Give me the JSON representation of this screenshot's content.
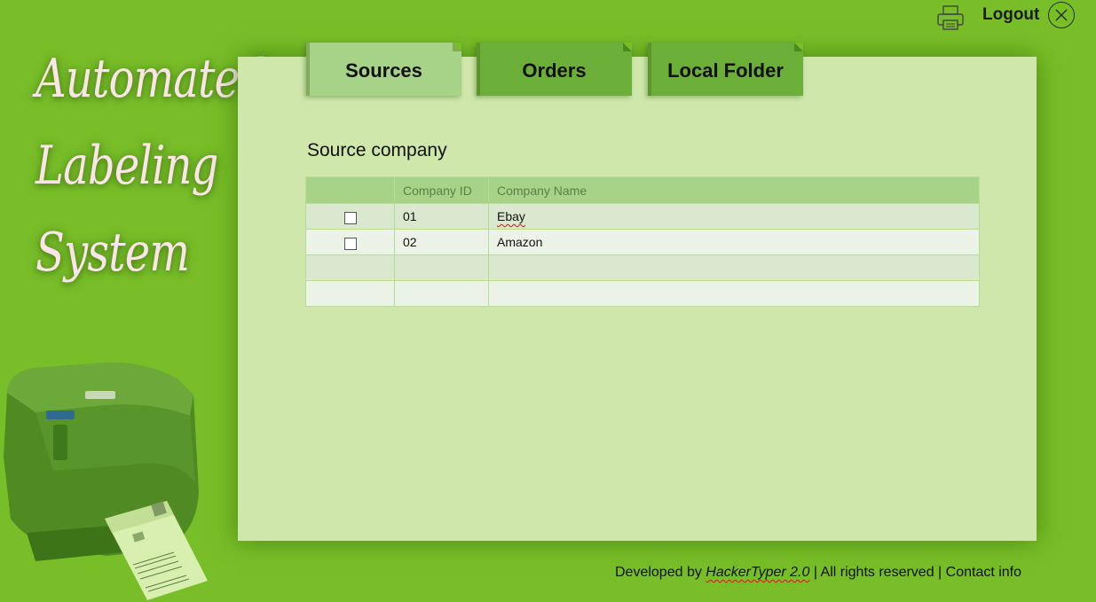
{
  "app": {
    "title_lines": [
      "Automated",
      "Labeling",
      "System"
    ]
  },
  "header": {
    "printer_icon": "printer-icon",
    "logout_label": "Logout",
    "close_icon": "close-icon"
  },
  "tabs": [
    {
      "label": "Sources",
      "active": true
    },
    {
      "label": "Orders",
      "active": false
    },
    {
      "label": "Local Folder",
      "active": false
    }
  ],
  "main": {
    "section_title": "Source company",
    "table": {
      "columns": [
        "",
        "Company ID",
        "Company Name"
      ],
      "rows": [
        {
          "checked": false,
          "id": "01",
          "name": "Ebay"
        },
        {
          "checked": false,
          "id": "02",
          "name": "Amazon"
        },
        {
          "checked": null,
          "id": "",
          "name": ""
        },
        {
          "checked": null,
          "id": "",
          "name": ""
        }
      ]
    }
  },
  "footer": {
    "prefix": "Developed by ",
    "developer": "HackerTyper 2.0",
    "rights": " | All rights reserved | ",
    "contact": "Contact info"
  },
  "colors": {
    "background": "#78be28",
    "panel": "#cfe7aa",
    "tab_active": "#a7d389",
    "tab_inactive": "#6caf38",
    "title_text": "#fbe4ea"
  }
}
